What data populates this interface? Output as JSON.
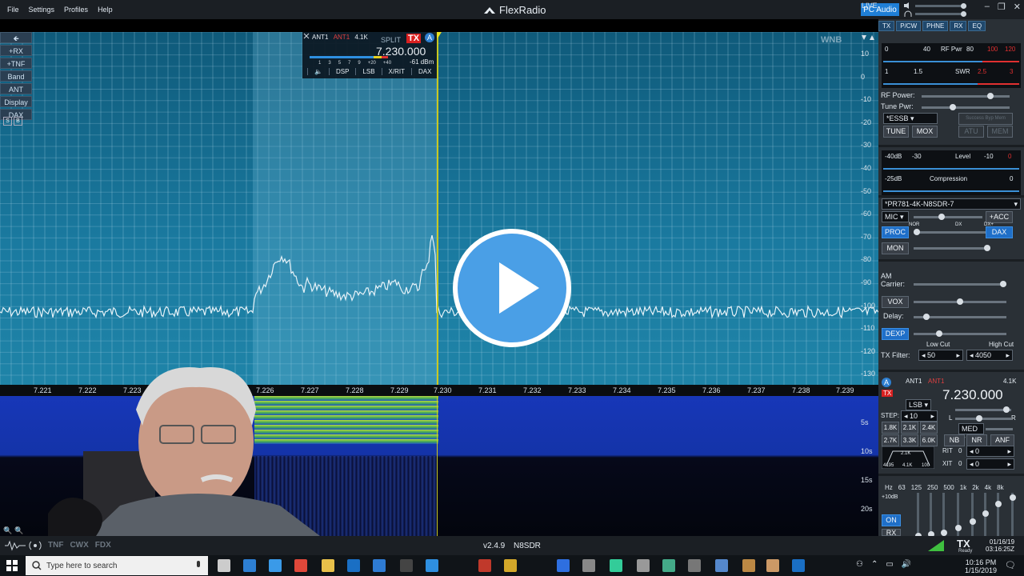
{
  "menu": [
    "File",
    "Settings",
    "Profiles",
    "Help"
  ],
  "app_title": "FlexRadio",
  "top_right": {
    "pc_audio": "PC Audio"
  },
  "left_toolbar": [
    "+RX",
    "+TNF",
    "Band",
    "ANT",
    "Display",
    "DAX"
  ],
  "panadapter": {
    "wnb": "WNB",
    "dbm_scale": [
      "10",
      "0",
      "-10",
      "-20",
      "-30",
      "-40",
      "-50",
      "-60",
      "-70",
      "-80",
      "-90",
      "-100",
      "-110",
      "-120",
      "-130"
    ]
  },
  "slice": {
    "ant_rx": "ANT1",
    "ant_tx": "ANT1",
    "bw": "4.1K",
    "split": "SPLIT",
    "tx": "TX",
    "letter": "A",
    "frequency": "7.230.000",
    "level": "-61 dBm",
    "smeter_ticks": [
      "1",
      "3",
      "5",
      "7",
      "9",
      "+20",
      "+40"
    ],
    "buttons": [
      "DSP",
      "LSB",
      "X/RIT",
      "DAX"
    ]
  },
  "freq_scale": [
    "7.221",
    "7.222",
    "7.223",
    "7.226",
    "7.227",
    "7.228",
    "7.229",
    "7.230",
    "7.231",
    "7.232",
    "7.233",
    "7.234",
    "7.235",
    "7.236",
    "7.237",
    "7.238",
    "7.239"
  ],
  "live": "LIVE",
  "waterfall_scale": [
    "5s",
    "10s",
    "15s",
    "20s"
  ],
  "waterfall_btns": [
    "S",
    "B"
  ],
  "status": {
    "left": [
      "TNF",
      "CWX",
      "FDX"
    ],
    "version": "v2.4.9",
    "callsign": "N8SDR",
    "tx": "TX",
    "tx_sub": "Ready",
    "date": "01/16/19",
    "utc": "03:16:25Z"
  },
  "taskbar": {
    "search_placeholder": "Type here to search",
    "time": "10:16 PM",
    "date": "1/15/2019"
  },
  "right_panel": {
    "tabs": [
      "TX",
      "P/CW",
      "PHNE",
      "RX",
      "EQ"
    ],
    "rf_meter": {
      "labels": [
        "0",
        "40",
        "RF Pwr",
        "80",
        "100",
        "120"
      ]
    },
    "swr_meter": {
      "labels": [
        "1",
        "1.5",
        "SWR",
        "2.5",
        "3"
      ]
    },
    "rf_power": "RF Power:",
    "rf_power_value": 0.78,
    "tune_power": "Tune Pwr:",
    "tune_power_value": 0.35,
    "tx_profile": "*ESSB",
    "atu_status": "Success Byp Mem",
    "tune": "TUNE",
    "mox": "MOX",
    "atu": "ATU",
    "mem": "MEM",
    "level_meter": {
      "labels": [
        "-40dB",
        "-30",
        "Level",
        "-10",
        "0"
      ]
    },
    "comp_meter": {
      "labels": [
        "-25dB",
        "Compression",
        "0"
      ]
    },
    "mic_profile": "*PR781-4K-N8SDR-7",
    "mic": "MIC",
    "acc": "+ACC",
    "proc": "PROC",
    "proc_labels": [
      "NOR",
      "DX",
      "DX+"
    ],
    "dax": "DAX",
    "mon": "MON",
    "am_carrier": "AM Carrier:",
    "vox": "VOX",
    "delay": "Delay:",
    "dexp": "DEXP",
    "low_cut": "Low Cut",
    "high_cut": "High Cut",
    "tx_filter": "TX Filter:",
    "low_cut_value": "50",
    "high_cut_value": "4050",
    "rx": {
      "ant_rx": "ANT1",
      "ant_tx": "ANT1",
      "bw": "4.1K",
      "tx": "TX",
      "letter": "A",
      "mode": "LSB",
      "frequency": "7.230.000",
      "step_label": "STEP:",
      "step": "10",
      "l": "L",
      "r": "R",
      "agc": "MED",
      "filters": [
        "1.8K",
        "2.1K",
        "2.4K",
        "2.7K",
        "3.3K",
        "6.0K"
      ],
      "nb": "NB",
      "nr": "NR",
      "anf": "ANF",
      "rit": "RIT",
      "xit": "XIT",
      "rit_value": "0",
      "xit_value": "0",
      "rit_offset": "0",
      "xit_offset": "0",
      "passband": [
        "2.1K",
        "4.1K",
        "100",
        "4195"
      ]
    },
    "eq": {
      "labels": [
        "Hz",
        "63",
        "125",
        "250",
        "500",
        "1k",
        "2k",
        "4k",
        "8k"
      ],
      "db": "+10dB",
      "on": "ON",
      "rx": "RX"
    }
  }
}
